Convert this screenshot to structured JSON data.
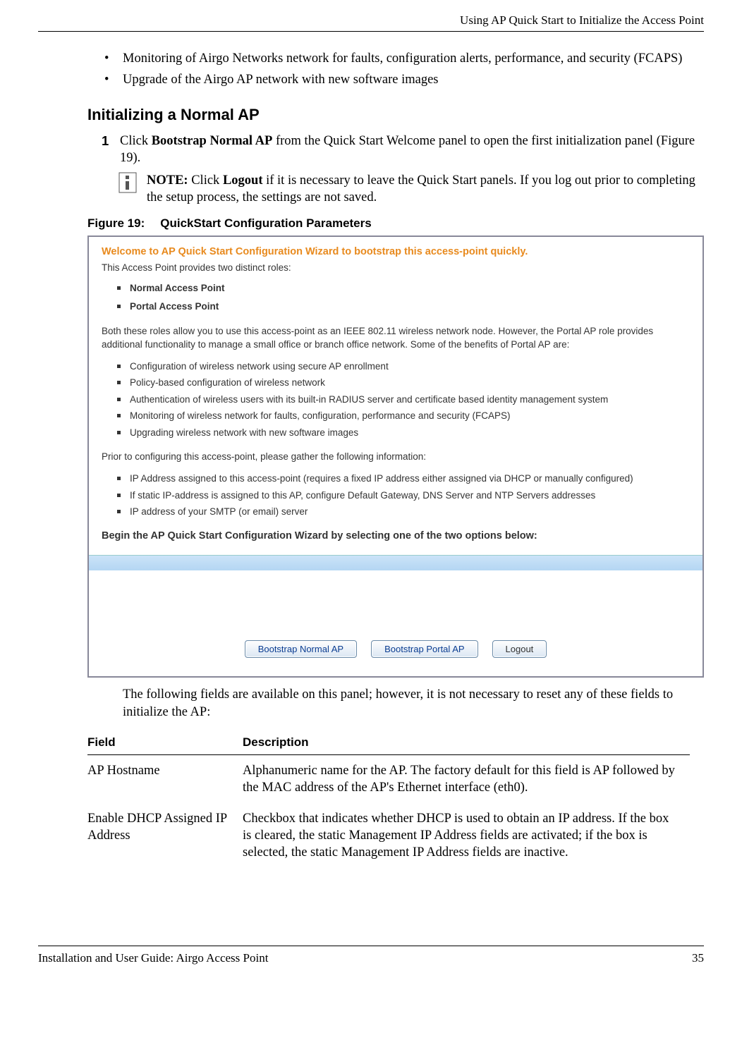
{
  "header": {
    "running_title": "Using AP Quick Start to Initialize the Access Point"
  },
  "bullets": {
    "b1": "Monitoring of Airgo Networks network for faults, configuration alerts, performance, and security (FCAPS)",
    "b2": "Upgrade of the Airgo AP network with new software images"
  },
  "section": {
    "title": "Initializing a Normal AP"
  },
  "step1": {
    "num": "1",
    "text_a": "Click ",
    "bold_a": "Bootstrap Normal AP",
    "text_b": " from the Quick Start Welcome panel to open the first initialization panel (Figure 19)."
  },
  "note": {
    "label": "NOTE:",
    "text_a": " Click ",
    "bold_a": "Logout",
    "text_b": " if it is necessary to leave the Quick Start panels. If you log out prior to completing the setup process, the settings are not saved."
  },
  "figure": {
    "no": "Figure 19:",
    "caption": "QuickStart Configuration Parameters"
  },
  "shot": {
    "title": "Welcome to AP Quick Start Configuration Wizard to bootstrap this access-point quickly.",
    "lead": "This Access Point provides two distinct roles:",
    "roles": {
      "r1": "Normal Access Point",
      "r2": "Portal Access Point"
    },
    "para1": "Both these roles allow you to use this access-point as an IEEE 802.11 wireless network node. However, the Portal AP role provides additional functionality to manage a small office or branch office network. Some of the benefits of Portal AP are:",
    "benefits": {
      "b1": "Configuration of wireless network using secure AP enrollment",
      "b2": "Policy-based configuration of wireless network",
      "b3": "Authentication of wireless users with its built-in RADIUS server and certificate based identity management system",
      "b4": "Monitoring of wireless network for faults, configuration, performance and security (FCAPS)",
      "b5": "Upgrading wireless network with new software images"
    },
    "para2": "Prior to configuring this access-point, please gather the following information:",
    "gather": {
      "g1": "IP Address assigned to this access-point (requires a fixed IP address either assigned via DHCP or manually configured)",
      "g2": "If static IP-address is assigned to this AP, configure Default Gateway, DNS Server and NTP Servers addresses",
      "g3": "IP address of your SMTP (or email) server"
    },
    "begin": "Begin the AP Quick Start Configuration Wizard by selecting one of the two options below:",
    "buttons": {
      "normal": "Bootstrap Normal AP",
      "portal": "Bootstrap Portal AP",
      "logout": "Logout"
    }
  },
  "after_figure": {
    "text": "The following fields are available on this panel; however, it is not necessary to reset any of these fields to initialize the AP:"
  },
  "table": {
    "h1": "Field",
    "h2": "Description",
    "r1c1": "AP Hostname",
    "r1c2": "Alphanumeric name for the AP. The factory default for this field is AP followed by the MAC address of the AP's Ethernet interface (eth0).",
    "r2c1": "Enable DHCP Assigned IP Address",
    "r2c2": "Checkbox that indicates whether DHCP is used to obtain an IP address. If the box is cleared, the static Management IP Address fields are activated; if the box is selected, the static Management IP Address fields are inactive."
  },
  "footer": {
    "left": "Installation and User Guide: Airgo Access Point",
    "right": "35"
  }
}
